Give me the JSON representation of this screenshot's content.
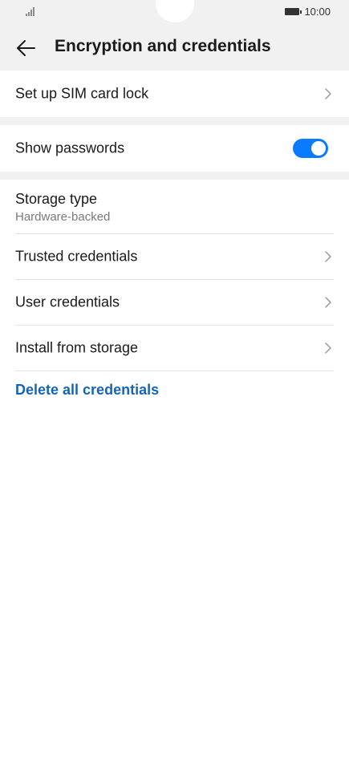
{
  "status_bar": {
    "time": "10:00"
  },
  "header": {
    "title": "Encryption and credentials"
  },
  "settings": {
    "sim_lock_label": "Set up SIM card lock",
    "show_passwords_label": "Show passwords",
    "show_passwords_enabled": true,
    "storage_type_label": "Storage type",
    "storage_type_value": "Hardware-backed",
    "trusted_credentials_label": "Trusted credentials",
    "user_credentials_label": "User credentials",
    "install_from_storage_label": "Install from storage",
    "delete_all_label": "Delete all credentials"
  },
  "colors": {
    "accent": "#0a7aff",
    "link": "#1565b5",
    "header_bg": "#f1f1f1"
  },
  "icons": {
    "back": "arrow-left-icon",
    "chevron": "chevron-right-icon",
    "signal": "signal-icon",
    "battery": "battery-icon"
  }
}
